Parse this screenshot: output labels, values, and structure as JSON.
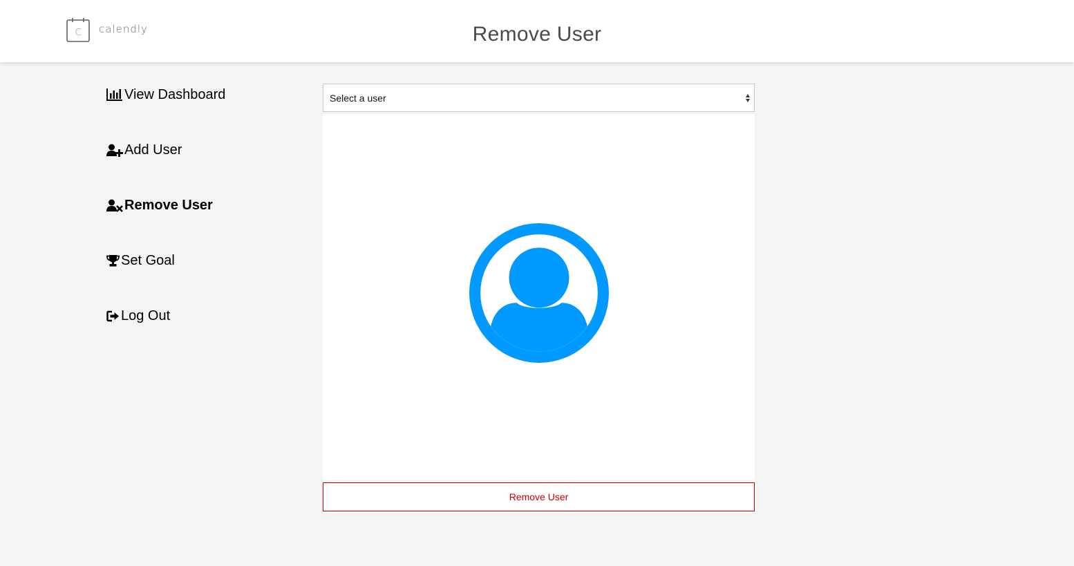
{
  "header": {
    "brand": {
      "logo_letter": "C",
      "name": "calendly",
      "icon": "calendar-icon"
    },
    "title": "Remove User"
  },
  "sidebar": {
    "items": [
      {
        "label": "View Dashboard",
        "icon": "bar-chart-icon",
        "active": false
      },
      {
        "label": "Add User",
        "icon": "user-plus-icon",
        "active": false
      },
      {
        "label": "Remove User",
        "icon": "user-times-icon",
        "active": true
      },
      {
        "label": "Set Goal",
        "icon": "trophy-icon",
        "active": false
      },
      {
        "label": "Log Out",
        "icon": "sign-out-icon",
        "active": false
      }
    ]
  },
  "main": {
    "user_select": {
      "selected": "Select a user"
    },
    "avatar": {
      "icon": "user-circle-icon",
      "color": "#0099ff"
    },
    "remove_button": {
      "label": "Remove User",
      "color": "#c90000"
    }
  },
  "colors": {
    "background": "#f4f4f4",
    "header_bg": "#ffffff",
    "accent": "#0099ff",
    "danger": "#c90000"
  }
}
